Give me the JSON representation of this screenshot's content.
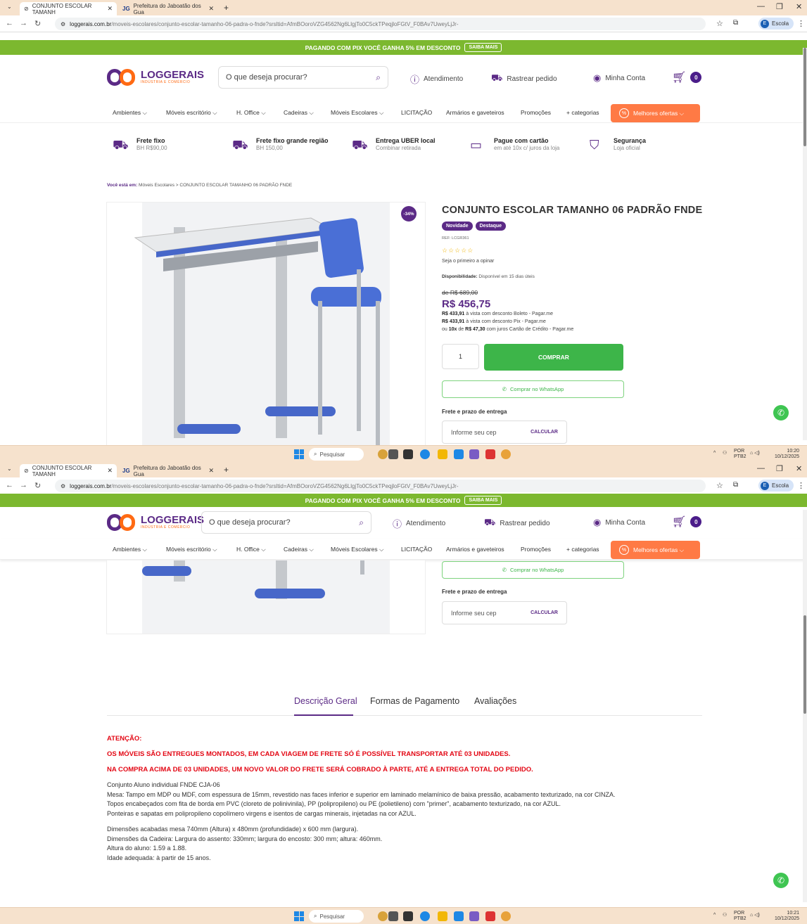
{
  "browser": {
    "tabs": [
      {
        "title": "CONJUNTO ESCOLAR TAMANH"
      },
      {
        "title": "Prefeitura do Jaboatão dos Gua",
        "favicon": "JG"
      }
    ],
    "url_host": "loggerais.com.br",
    "url_path": "/moveis-escolares/conjunto-escolar-tamanho-06-padra-o-fnde?srsltid=AfmBOoroVZG4562Ng6LlgjTo0C5ckTPeqjloFGtV_F0BAv7UweyLjJr-",
    "profile": "Escola",
    "profile_initial": "E"
  },
  "promo": {
    "text": "PAGANDO COM PIX VOCÊ GANHA 5% EM DESCONTO",
    "button": "SAIBA MAIS"
  },
  "header": {
    "logo_name": "LOGGERAIS",
    "logo_sub": "INDÚSTRIA E COMÉRCIO",
    "search_placeholder": "O que deseja procurar?",
    "atendimento": "Atendimento",
    "rastrear": "Rastrear pedido",
    "conta": "Minha Conta",
    "cart_count": "0"
  },
  "menu": {
    "items": [
      "Ambientes ⌵",
      "Móveis escritório ⌵",
      "H. Office ⌵",
      "Cadeiras ⌵",
      "Móveis Escolares ⌵",
      "LICITAÇÃO",
      "Armários e gaveteiros",
      "Promoções",
      "+ categorias"
    ],
    "best": "Melhores ofertas ⌵"
  },
  "benefits": [
    {
      "title": "Frete fixo",
      "sub": "BH R$90,00"
    },
    {
      "title": "Frete fixo grande região",
      "sub": "BH 150,00"
    },
    {
      "title": "Entrega UBER local",
      "sub": "Combinar retirada"
    },
    {
      "title": "Pague com cartão",
      "sub": "em até 10x c/ juros da loja"
    },
    {
      "title": "Segurança",
      "sub": "Loja oficial"
    }
  ],
  "breadcrumb": {
    "label": "Você está em:",
    "path": "Móveis Escolares  >  CONJUNTO ESCOLAR TAMANHO 06 PADRÃO FNDE"
  },
  "product": {
    "discount": "-34%",
    "title": "CONJUNTO ESCOLAR TAMANHO 06 PADRÃO FNDE",
    "tags": [
      "Novidade",
      "Destaque"
    ],
    "ref": "REF: LCGR361",
    "stars": "☆☆☆☆☆",
    "rating_cta": "Seja o primeiro a opinar",
    "availability_label": "Disponibilidade:",
    "availability": "Disponível em 15 dias úteis",
    "old_price": "de R$ 689,00",
    "price": "R$ 456,75",
    "boleto_value": "R$ 433,91",
    "boleto_text": "à vista com desconto Boleto - Pagar.me",
    "pix_value": "R$ 433,91",
    "pix_text": "à vista com desconto Pix - Pagar.me",
    "install_pre": "ou",
    "install_n": "10x",
    "install_de": "de",
    "install_value": "R$ 47,30",
    "install_text": "com juros Cartão de Crédito - Pagar.me",
    "qty": "1",
    "buy": "COMPRAR",
    "whatsapp": "Comprar no WhatsApp",
    "frete_title": "Frete e prazo de entrega",
    "cep_placeholder": "Informe seu cep",
    "calc": "CALCULAR"
  },
  "tabs": [
    "Descrição Geral",
    "Formas de Pagamento",
    "Avaliações"
  ],
  "description": {
    "attention": "ATENÇÃO:",
    "warn1": "OS MÓVEIS SÃO ENTREGUES MONTADOS, EM CADA VIAGEM DE FRETE SÓ É POSSÍVEL TRANSPORTAR ATÉ 03 UNIDADES.",
    "warn2": "NA COMPRA ACIMA DE 03 UNIDADES, UM NOVO VALOR DO FRETE SERÁ COBRADO À PARTE, ATÉ A ENTREGA TOTAL DO PEDIDO.",
    "p1": [
      "Conjunto Aluno individual FNDE CJA-06",
      "Mesa: Tampo em MDP ou MDF, com espessura de 15mm, revestido nas faces inferior e superior em laminado melamínico de baixa pressão, acabamento texturizado, na cor CINZA.",
      "Topos encabeçados com fita de borda em PVC (cloreto de polinivinila), PP (polipropileno) ou PE (polietileno) com \"primer\", acabamento texturizado, na cor AZUL.",
      "Ponteiras e sapatas em polipropileno copolímero virgens e isentos de cargas minerais, injetadas na cor AZUL."
    ],
    "p2": [
      "Dimensões acabadas mesa 740mm (Altura) x 480mm (profundidade) x 600 mm (largura).",
      "Dimensões da Cadeira: Largura do assento: 330mm; largura do encosto: 300 mm; altura: 460mm.",
      "Altura do aluno:  1.59 a 1.88.",
      "Idade adequada: à partir de 15 anos."
    ]
  },
  "taskbar": {
    "search": "Pesquisar",
    "lang1": "POR",
    "lang2": "PTB2",
    "time1": "10:20",
    "time2": "10:21",
    "date": "10/12/2025"
  },
  "colors": {
    "brand_purple": "#5b2a86",
    "brand_orange": "#ff6a13",
    "promo_green": "#7cb82f",
    "buy_green": "#3db549",
    "alert_red": "#e30613"
  }
}
